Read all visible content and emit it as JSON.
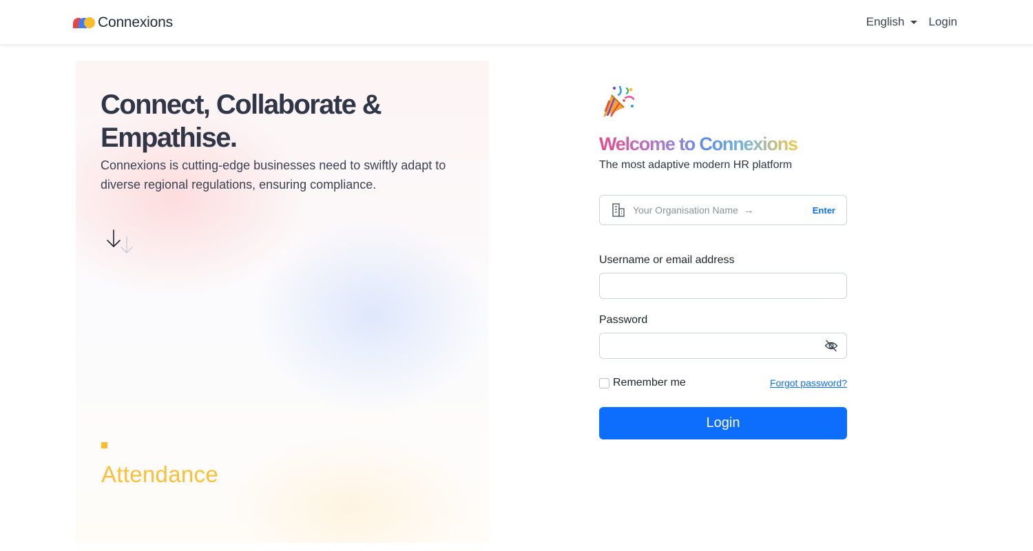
{
  "nav": {
    "brand_name": "Connexions",
    "language": "English",
    "login_link": "Login"
  },
  "hero": {
    "title": "Connect, Collaborate & Empathise.",
    "description": "Connexions is cutting-edge businesses need to swiftly adapt to diverse regional regulations, ensuring compliance.",
    "feature_label": "Attendance",
    "feature_color": "#fcbf3a"
  },
  "form": {
    "welcome": "Welcome to Connexions",
    "subtitle": "The most adaptive modern HR platform",
    "org_placeholder": "Your Organisation Name",
    "org_enter": "Enter",
    "username_label": "Username or email address",
    "username_value": "",
    "password_label": "Password",
    "password_value": "",
    "remember_label": "Remember me",
    "remember_checked": false,
    "forgot_link": "Forgot password?",
    "login_button": "Login"
  },
  "colors": {
    "primary": "#0d6efd",
    "heading": "#2e3648",
    "accent_yellow": "#fdbb2f"
  },
  "icons": {
    "brand": "connexions-logo-icon",
    "org": "building-icon",
    "org_arrow": "arrow-right-icon",
    "password_toggle": "eye-slash-icon",
    "scroll": "arrow-down-icon",
    "welcome": "party-popper-icon"
  }
}
